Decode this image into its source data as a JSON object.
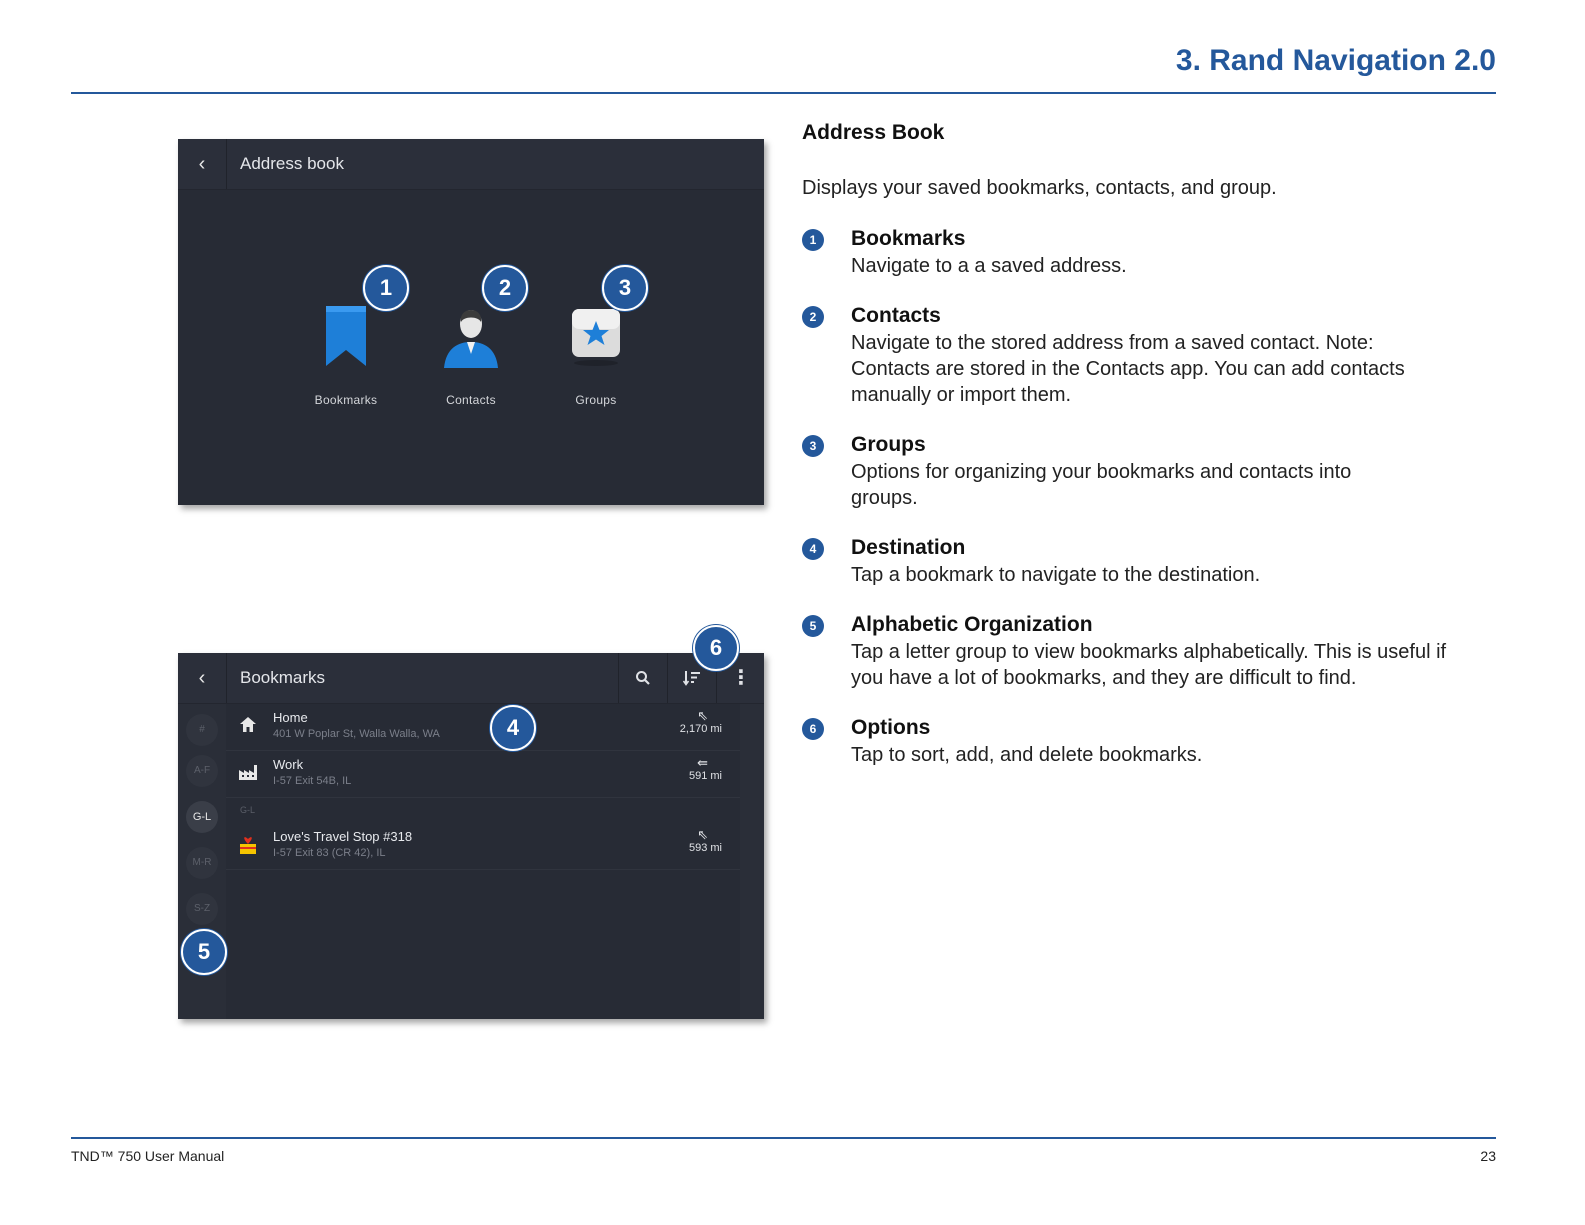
{
  "header": {
    "chapter_title": "3. Rand Navigation 2.0"
  },
  "screen1": {
    "back_glyph": "‹",
    "title": "Address book",
    "tiles": [
      {
        "label": "Bookmarks",
        "icon": "bookmark-icon"
      },
      {
        "label": "Contacts",
        "icon": "contact-person-icon"
      },
      {
        "label": "Groups",
        "icon": "groups-star-icon"
      }
    ],
    "callouts": [
      "1",
      "2",
      "3"
    ]
  },
  "screen2": {
    "back_glyph": "‹",
    "title": "Bookmarks",
    "tools": {
      "search_glyph": "⚲",
      "sort_glyph": "⇂≡",
      "more_glyph": "⋮"
    },
    "alpha_items": [
      "#",
      "A-F",
      "G-L",
      "M-R",
      "S-Z"
    ],
    "active_alpha": "G-L",
    "group_header": "G-L",
    "rows": [
      {
        "name": "Home",
        "address": "401 W Poplar St, Walla Walla, WA",
        "distance": "2,170 mi",
        "icon": "home-icon"
      },
      {
        "name": "Work",
        "address": "I-57 Exit 54B, IL",
        "distance": "591 mi",
        "icon": "factory-icon"
      },
      {
        "name": "Love's Travel Stop #318",
        "address": "I-57 Exit 83 (CR 42), IL",
        "distance": "593 mi",
        "icon": "loves-logo-icon"
      }
    ],
    "callouts": [
      "4",
      "5",
      "6"
    ]
  },
  "content": {
    "heading": "Address Book",
    "intro": "Displays your saved bookmarks, contacts, and group.",
    "items": [
      {
        "num": "1",
        "title": "Bookmarks",
        "body": "Navigate to a a saved address."
      },
      {
        "num": "2",
        "title": "Contacts",
        "body": "Navigate to the stored address from a saved contact. Note: Contacts are stored in the Contacts app. You can add contacts manually or import them."
      },
      {
        "num": "3",
        "title": "Groups",
        "body": "Options for organizing your bookmarks and contacts into groups."
      },
      {
        "num": "4",
        "title": "Destination",
        "body": "Tap a bookmark to navigate to the destination."
      },
      {
        "num": "5",
        "title": "Alphabetic Organization",
        "body": "Tap a letter group to view bookmarks alphabetically. This is useful if you have a lot of bookmarks, and they are difficult to find."
      },
      {
        "num": "6",
        "title": "Options",
        "body": "Tap to sort, add, and delete bookmarks."
      }
    ]
  },
  "footer": {
    "manual_name": "TND™ 750 User Manual",
    "page_number": "23"
  },
  "colors": {
    "accent": "#24589b",
    "screen_bg": "#272b35",
    "icon_blue": "#1e7fd8"
  }
}
